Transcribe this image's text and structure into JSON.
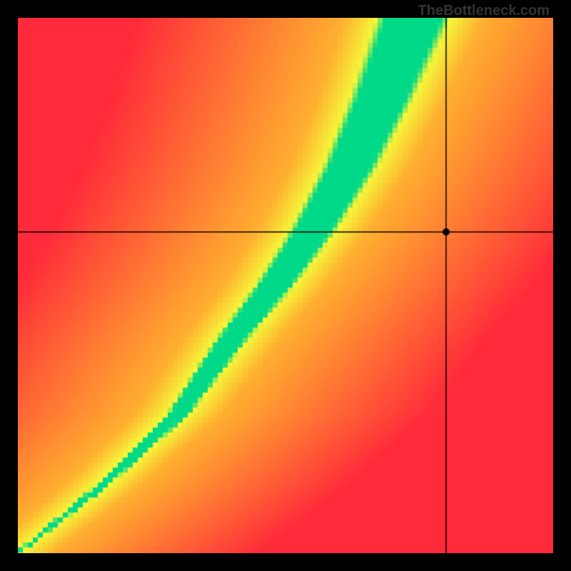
{
  "watermark": "TheBottleneck.com",
  "chart_data": {
    "type": "heatmap",
    "title": "",
    "xlabel": "",
    "ylabel": "",
    "xlim": [
      0,
      100
    ],
    "ylim": [
      0,
      100
    ],
    "marker": {
      "x": 80,
      "y": 60
    },
    "crosshair": {
      "x": 80,
      "y": 60
    },
    "ridge": {
      "description": "Green optimal curve from bottom-left to top, convex, passing through roughly (0,0)->(40,40)->(58,60)->(70,85)->(78,100)",
      "points": [
        {
          "x": 0,
          "y": 0
        },
        {
          "x": 15,
          "y": 12
        },
        {
          "x": 30,
          "y": 26
        },
        {
          "x": 40,
          "y": 40
        },
        {
          "x": 48,
          "y": 50
        },
        {
          "x": 55,
          "y": 60
        },
        {
          "x": 62,
          "y": 72
        },
        {
          "x": 68,
          "y": 85
        },
        {
          "x": 74,
          "y": 100
        }
      ],
      "width_start": 1,
      "width_end": 14
    },
    "colors": {
      "ridge": "#00d988",
      "near": "#f6f63a",
      "mid": "#ffb030",
      "far": "#ff2a3a"
    }
  }
}
